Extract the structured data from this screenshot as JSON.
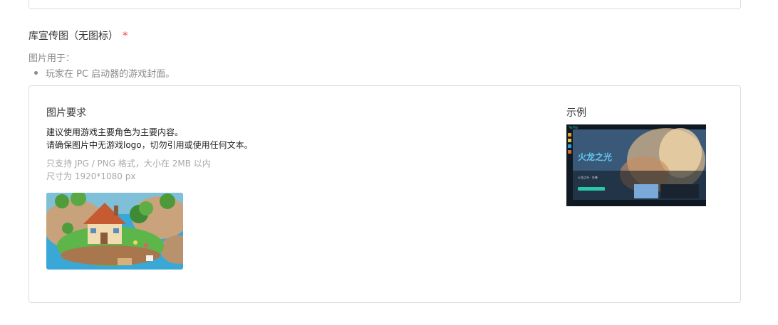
{
  "field": {
    "title": "库宣传图（无图标）",
    "required_mark": "*",
    "usage_label": "图片用于：",
    "usage_items": [
      "玩家在 PC 启动器的游戏封面。"
    ]
  },
  "requirements": {
    "title": "图片要求",
    "line1": "建议使用游戏主要角色为主要内容。",
    "line2": "请确保图片中无游戏logo，切勿引用或使用任何文本。",
    "spec1": "只支持 JPG / PNG 格式，大小在 2MB 以内",
    "spec2": "尺寸为 1920*1080 px"
  },
  "example": {
    "title": "示例",
    "game_title": "火龙之光",
    "brand": "TapTap",
    "subtitle": "火龙之光 · 先锋"
  }
}
